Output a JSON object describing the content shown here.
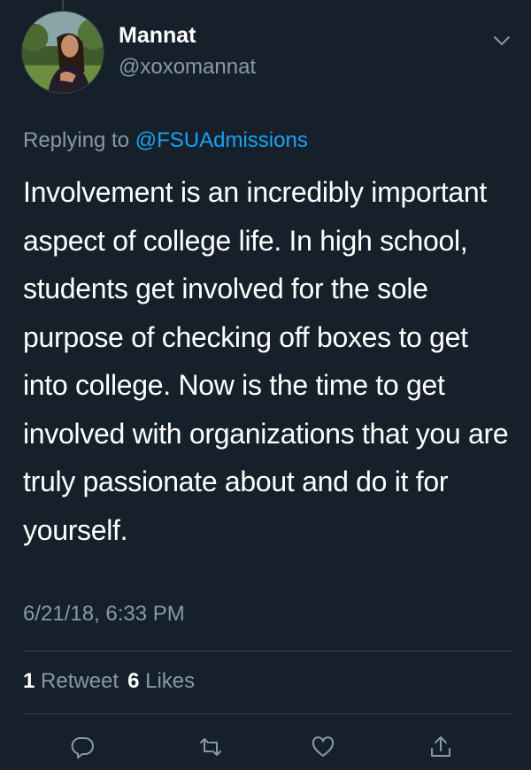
{
  "author": {
    "display_name": "Mannat",
    "handle": "@xoxomannat"
  },
  "reply_context": {
    "prefix": "Replying to",
    "mention": "@FSUAdmissions"
  },
  "tweet_text": "Involvement is an incredibly important aspect of college life. In high school, students get involved for the sole purpose of checking off boxes to get into college. Now is the time to get involved with organizations that you are truly passionate about and do it for yourself.",
  "timestamp": "6/21/18, 6:33 PM",
  "stats": {
    "retweets_count": "1",
    "retweets_label": "Retweet",
    "likes_count": "6",
    "likes_label": "Likes"
  },
  "actions": [
    "reply-icon",
    "retweet-icon",
    "like-icon",
    "share-icon"
  ],
  "colors": {
    "background": "#15202b",
    "text": "#ffffff",
    "secondary_text": "#8899a6",
    "link": "#1da1f2",
    "divider": "#38444d"
  }
}
